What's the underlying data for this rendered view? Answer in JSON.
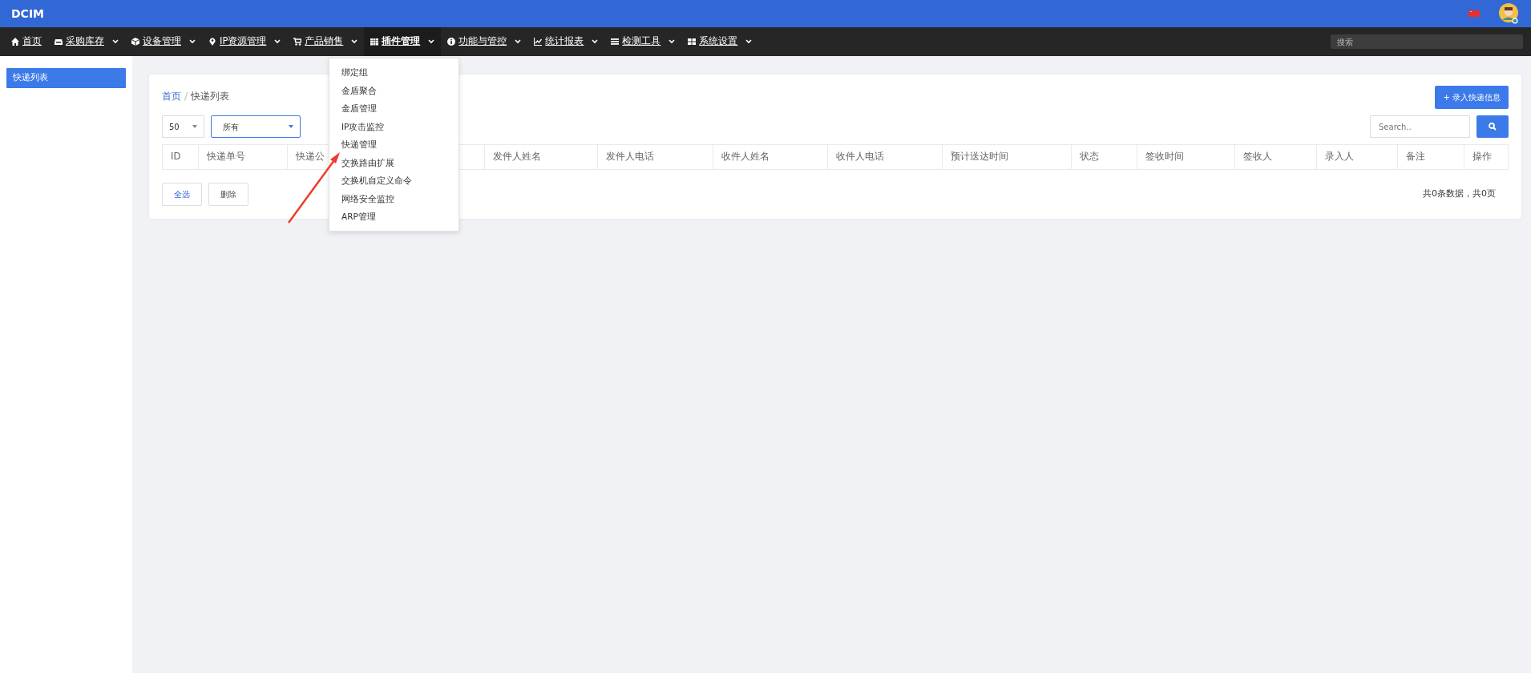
{
  "brand": "DCIM",
  "nav": [
    {
      "label": "首页",
      "caret": false,
      "selected": false
    },
    {
      "label": "采购库存",
      "caret": true,
      "selected": false
    },
    {
      "label": "设备管理",
      "caret": true,
      "selected": false
    },
    {
      "label": "IP资源管理",
      "caret": true,
      "selected": false
    },
    {
      "label": "产品销售",
      "caret": true,
      "selected": false
    },
    {
      "label": "插件管理",
      "caret": true,
      "selected": true
    },
    {
      "label": "功能与管控",
      "caret": true,
      "selected": false
    },
    {
      "label": "统计报表",
      "caret": true,
      "selected": false
    },
    {
      "label": "检测工具",
      "caret": true,
      "selected": false
    },
    {
      "label": "系统设置",
      "caret": true,
      "selected": false
    }
  ],
  "nav_search": {
    "placeholder": "搜索"
  },
  "dropdown": [
    "绑定组",
    "金盾聚合",
    "金盾管理",
    "IP攻击监控",
    "快递管理",
    "交换路由扩展",
    "交换机自定义命令",
    "网络安全监控",
    "ARP管理"
  ],
  "sidebar": [
    {
      "label": "快递列表",
      "selected": true
    }
  ],
  "breadcrumb": [
    "首页",
    "快递列表"
  ],
  "breadcrumb_separator": "/",
  "add_button": "+ 录入快递信息",
  "page_size": "50",
  "status_filter": "所有",
  "search": {
    "placeholder": "Search.."
  },
  "table": {
    "columns": [
      "ID",
      "快递单号",
      "快递公",
      "发件人姓名",
      "发件人电话",
      "收件人姓名",
      "收件人电话",
      "预计送达时间",
      "状态",
      "签收时间",
      "签收人",
      "录入人",
      "备注",
      "操作"
    ]
  },
  "buttons": [
    "全选",
    "删除"
  ],
  "summary": "共0条数据，共0页"
}
